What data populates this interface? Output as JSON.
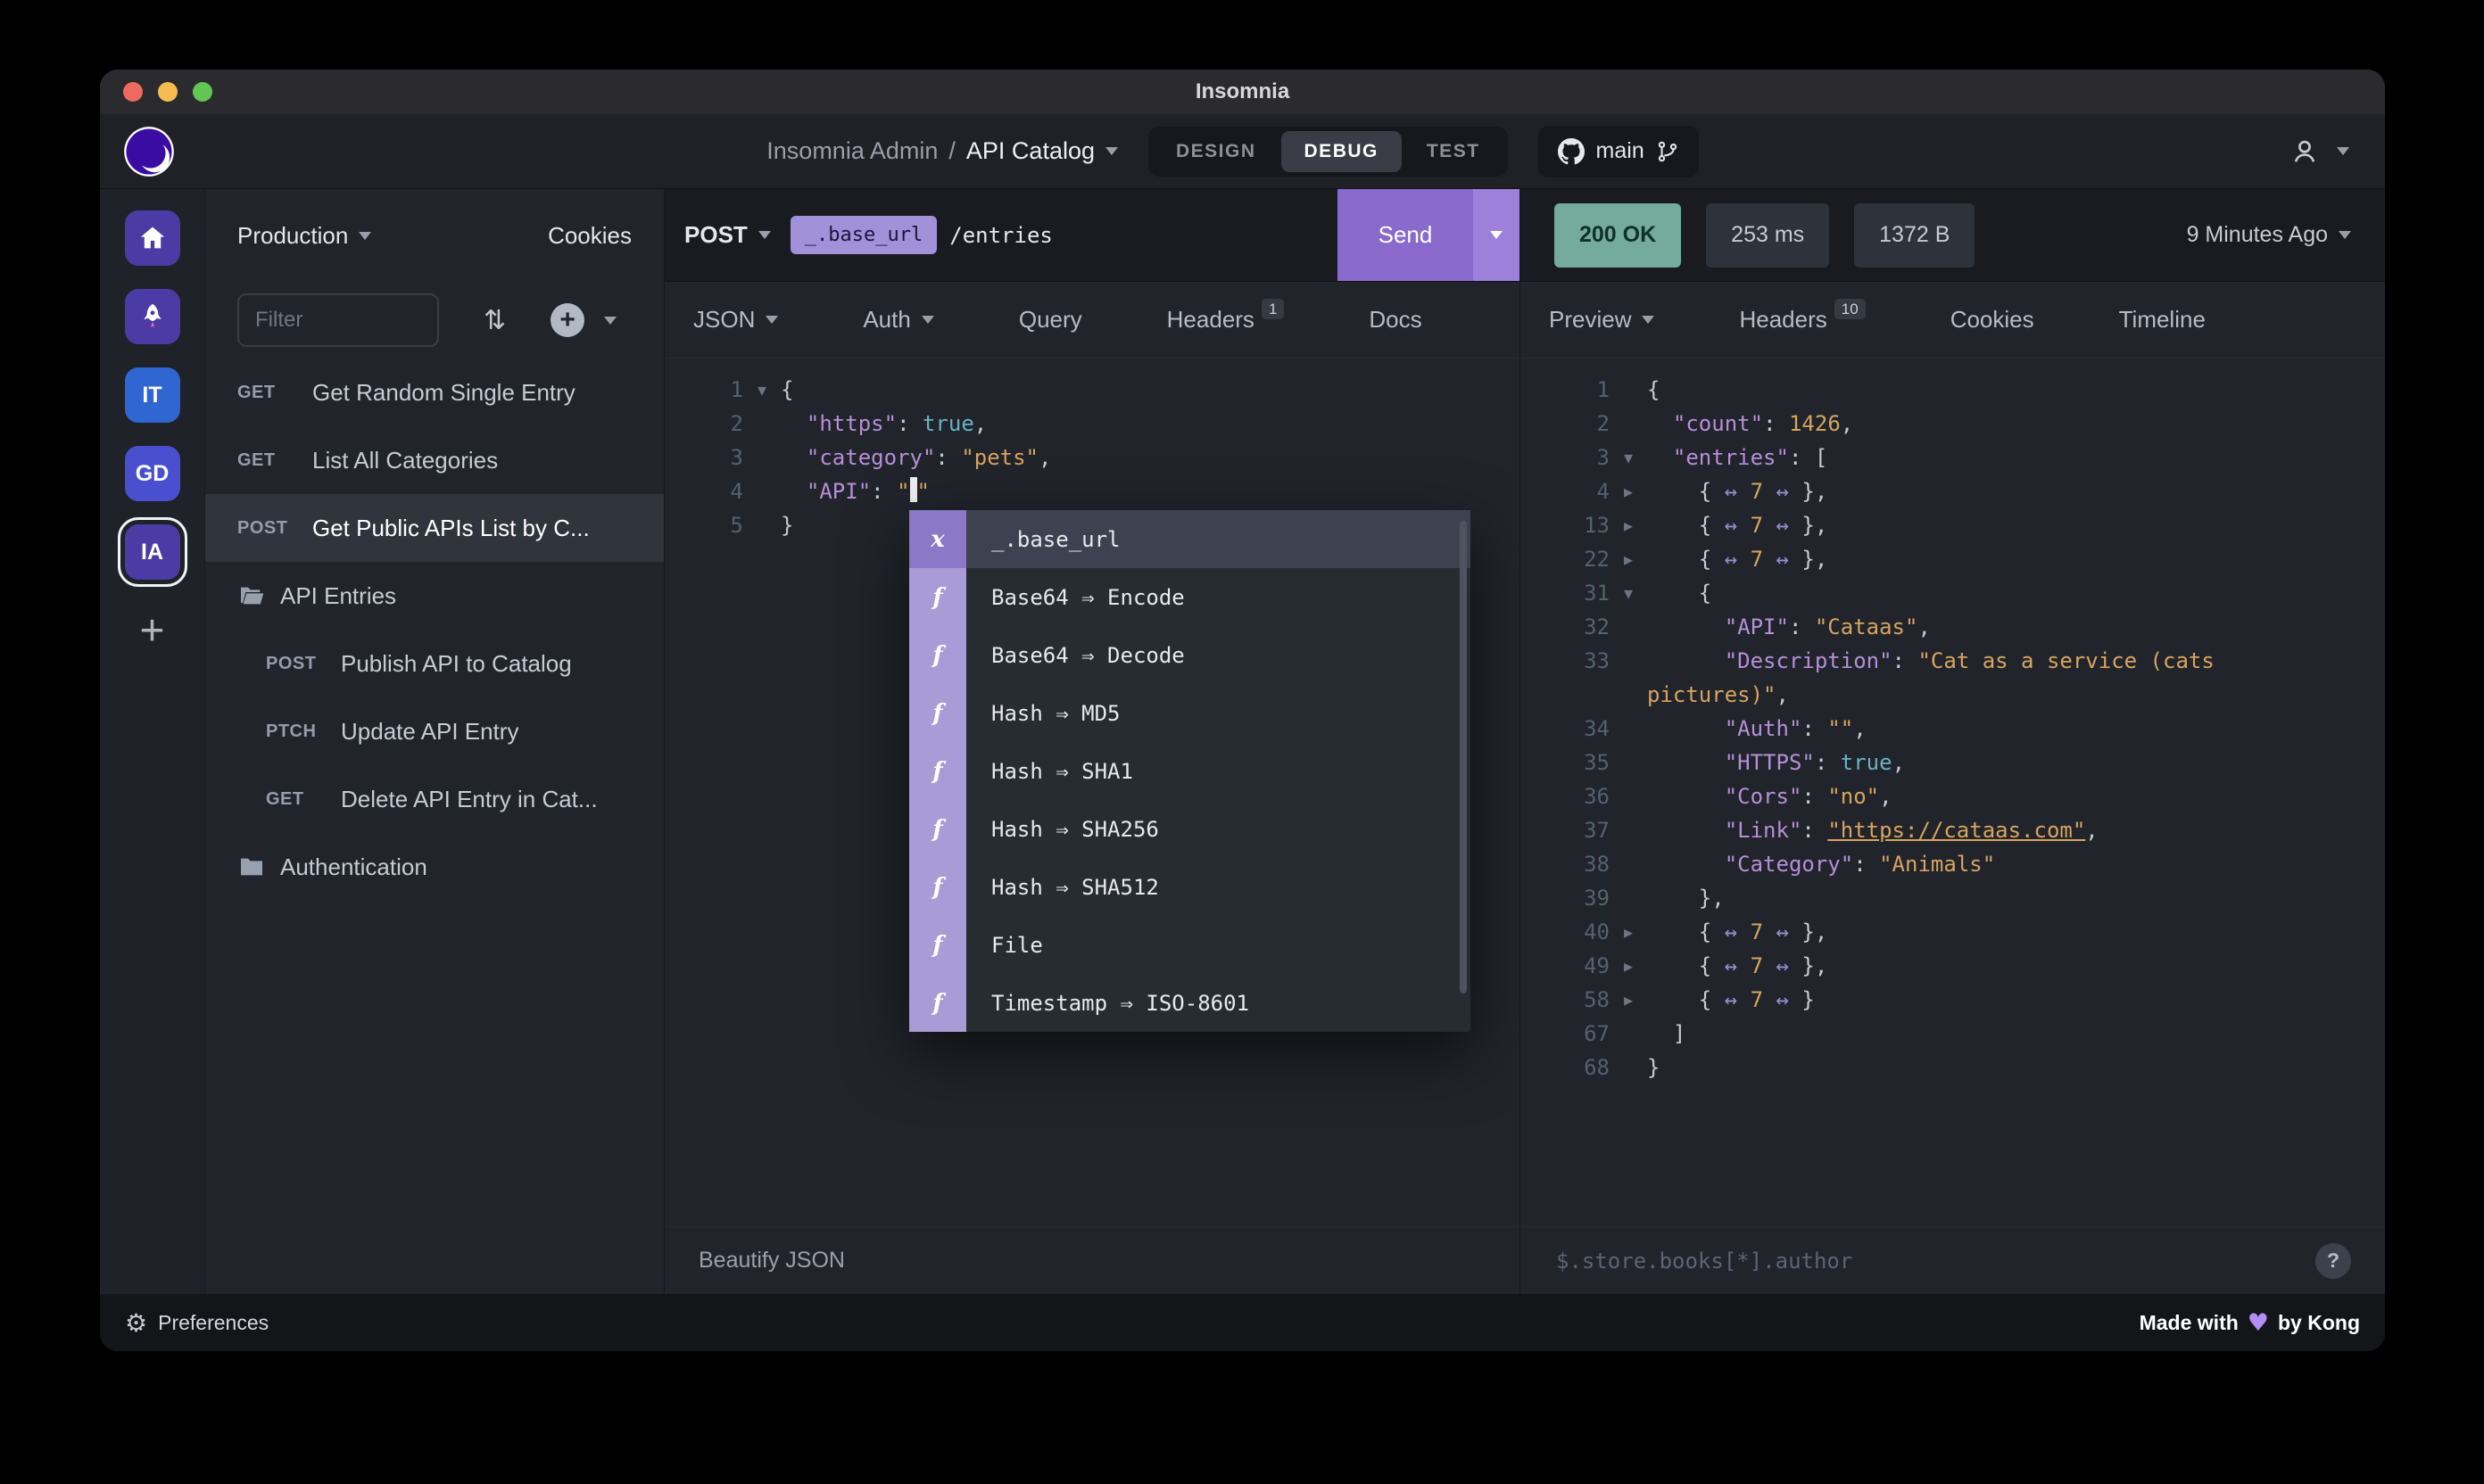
{
  "titlebar": {
    "title": "Insomnia"
  },
  "header": {
    "workspace": "Insomnia Admin",
    "separator": "/",
    "project": "API Catalog",
    "modes": [
      {
        "label": "DESIGN",
        "active": false
      },
      {
        "label": "DEBUG",
        "active": true
      },
      {
        "label": "TEST",
        "active": false
      }
    ],
    "branch": "main"
  },
  "colors": {
    "accent_purple": "#8a69cc",
    "tag_purple": "#a091d9",
    "status_ok_teal": "#74ab9d",
    "syntax_key": "#b58fd8",
    "syntax_string": "#d6a45f",
    "syntax_bool": "#69b2c2"
  },
  "icons": {
    "gear": "⚙",
    "sort": "⇅",
    "plus": "+",
    "help": "?",
    "heart": "♥"
  },
  "rail": [
    {
      "name": "home",
      "icon": "home",
      "color": "#4d3ba5",
      "label": ""
    },
    {
      "name": "rocket",
      "icon": "rocket",
      "color": "#4d3ba5",
      "label": ""
    },
    {
      "name": "workspace-it",
      "color": "#2f66d2",
      "label": "IT"
    },
    {
      "name": "workspace-gd",
      "color": "#4a4fd0",
      "label": "GD"
    },
    {
      "name": "workspace-ia",
      "color": "#4d3ba5",
      "label": "IA",
      "selected": true
    },
    {
      "name": "add-workspace",
      "kind": "add",
      "label": "+"
    }
  ],
  "sidebar": {
    "environment": "Production",
    "cookies": "Cookies",
    "filter_placeholder": "Filter",
    "items": [
      {
        "kind": "request",
        "method": "GET",
        "name": "Get Random Single Entry"
      },
      {
        "kind": "request",
        "method": "GET",
        "name": "List All Categories"
      },
      {
        "kind": "request",
        "method": "POST",
        "name": "Get Public APIs List by C...",
        "selected": true
      },
      {
        "kind": "folder",
        "name": "API Entries",
        "open": true
      },
      {
        "kind": "request",
        "method": "POST",
        "name": "Publish API to Catalog",
        "indent": true
      },
      {
        "kind": "request",
        "method": "PTCH",
        "name": "Update API Entry",
        "indent": true
      },
      {
        "kind": "request",
        "method": "GET",
        "name": "Delete API Entry in Cat...",
        "indent": true
      },
      {
        "kind": "folder",
        "name": "Authentication",
        "open": false
      }
    ]
  },
  "request": {
    "method": "POST",
    "url_tag": "_.base_url",
    "url_path": "/entries",
    "send": "Send",
    "tabs": [
      {
        "label": "JSON",
        "caret": true
      },
      {
        "label": "Auth",
        "caret": true
      },
      {
        "label": "Query"
      },
      {
        "label": "Headers",
        "badge": "1"
      },
      {
        "label": "Docs"
      }
    ],
    "editor_lines": [
      {
        "num": "1",
        "fold": "open",
        "tokens": [
          {
            "t": "{"
          }
        ]
      },
      {
        "num": "2",
        "tokens": [
          {
            "t": "  "
          },
          {
            "t": "\"https\"",
            "c": "key"
          },
          {
            "t": ": "
          },
          {
            "t": "true",
            "c": "bool"
          },
          {
            "t": ","
          }
        ]
      },
      {
        "num": "3",
        "tokens": [
          {
            "t": "  "
          },
          {
            "t": "\"category\"",
            "c": "key"
          },
          {
            "t": ": "
          },
          {
            "t": "\"pets\"",
            "c": "str"
          },
          {
            "t": ","
          }
        ]
      },
      {
        "num": "4",
        "tokens": [
          {
            "t": "  "
          },
          {
            "t": "\"API\"",
            "c": "key"
          },
          {
            "t": ": "
          },
          {
            "t": "\"",
            "c": "str"
          },
          {
            "t": "",
            "c": "cursor"
          },
          {
            "t": "\"",
            "c": "str"
          }
        ]
      },
      {
        "num": "5",
        "tokens": [
          {
            "t": "}"
          }
        ]
      }
    ],
    "autocomplete": [
      {
        "kind": "x",
        "label": "_.base_url",
        "selected": true
      },
      {
        "kind": "f",
        "label": "Base64 ⇒ Encode"
      },
      {
        "kind": "f",
        "label": "Base64 ⇒ Decode"
      },
      {
        "kind": "f",
        "label": "Hash ⇒ MD5"
      },
      {
        "kind": "f",
        "label": "Hash ⇒ SHA1"
      },
      {
        "kind": "f",
        "label": "Hash ⇒ SHA256"
      },
      {
        "kind": "f",
        "label": "Hash ⇒ SHA512"
      },
      {
        "kind": "f",
        "label": "File"
      },
      {
        "kind": "f",
        "label": "Timestamp ⇒ ISO-8601"
      }
    ],
    "beautify": "Beautify JSON"
  },
  "response": {
    "status": "200 OK",
    "time": "253 ms",
    "size": "1372 B",
    "age": "9 Minutes Ago",
    "tabs": [
      {
        "label": "Preview",
        "caret": true
      },
      {
        "label": "Headers",
        "badge": "10"
      },
      {
        "label": "Cookies"
      },
      {
        "label": "Timeline"
      }
    ],
    "editor_lines": [
      {
        "num": "1",
        "tokens": [
          {
            "t": "{"
          }
        ]
      },
      {
        "num": "2",
        "tokens": [
          {
            "t": "  "
          },
          {
            "t": "\"count\"",
            "c": "key"
          },
          {
            "t": ": "
          },
          {
            "t": "1426",
            "c": "num"
          },
          {
            "t": ","
          }
        ]
      },
      {
        "num": "3",
        "fold": "open",
        "tokens": [
          {
            "t": "  "
          },
          {
            "t": "\"entries\"",
            "c": "key"
          },
          {
            "t": ": ["
          }
        ]
      },
      {
        "num": "4",
        "fold": "closed",
        "tokens": [
          {
            "t": "    { "
          },
          {
            "t": "↔",
            "c": "arrow"
          },
          {
            "t": " "
          },
          {
            "t": "7",
            "c": "num"
          },
          {
            "t": " "
          },
          {
            "t": "↔",
            "c": "arrow"
          },
          {
            "t": " },"
          }
        ]
      },
      {
        "num": "13",
        "fold": "closed",
        "tokens": [
          {
            "t": "    { "
          },
          {
            "t": "↔",
            "c": "arrow"
          },
          {
            "t": " "
          },
          {
            "t": "7",
            "c": "num"
          },
          {
            "t": " "
          },
          {
            "t": "↔",
            "c": "arrow"
          },
          {
            "t": " },"
          }
        ]
      },
      {
        "num": "22",
        "fold": "closed",
        "tokens": [
          {
            "t": "    { "
          },
          {
            "t": "↔",
            "c": "arrow"
          },
          {
            "t": " "
          },
          {
            "t": "7",
            "c": "num"
          },
          {
            "t": " "
          },
          {
            "t": "↔",
            "c": "arrow"
          },
          {
            "t": " },"
          }
        ]
      },
      {
        "num": "31",
        "fold": "open",
        "tokens": [
          {
            "t": "    {"
          }
        ]
      },
      {
        "num": "32",
        "tokens": [
          {
            "t": "      "
          },
          {
            "t": "\"API\"",
            "c": "key"
          },
          {
            "t": ": "
          },
          {
            "t": "\"Cataas\"",
            "c": "str"
          },
          {
            "t": ","
          }
        ]
      },
      {
        "num": "33",
        "tokens": [
          {
            "t": "      "
          },
          {
            "t": "\"Description\"",
            "c": "key"
          },
          {
            "t": ": "
          },
          {
            "t": "\"Cat as a service (cats",
            "c": "str"
          }
        ]
      },
      {
        "num": "",
        "tokens": [
          {
            "t": "pictures)\"",
            "c": "str"
          },
          {
            "t": ","
          }
        ]
      },
      {
        "num": "34",
        "tokens": [
          {
            "t": "      "
          },
          {
            "t": "\"Auth\"",
            "c": "key"
          },
          {
            "t": ": "
          },
          {
            "t": "\"\"",
            "c": "str"
          },
          {
            "t": ","
          }
        ]
      },
      {
        "num": "35",
        "tokens": [
          {
            "t": "      "
          },
          {
            "t": "\"HTTPS\"",
            "c": "key"
          },
          {
            "t": ": "
          },
          {
            "t": "true",
            "c": "bool"
          },
          {
            "t": ","
          }
        ]
      },
      {
        "num": "36",
        "tokens": [
          {
            "t": "      "
          },
          {
            "t": "\"Cors\"",
            "c": "key"
          },
          {
            "t": ": "
          },
          {
            "t": "\"no\"",
            "c": "str"
          },
          {
            "t": ","
          }
        ]
      },
      {
        "num": "37",
        "tokens": [
          {
            "t": "      "
          },
          {
            "t": "\"Link\"",
            "c": "key"
          },
          {
            "t": ": "
          },
          {
            "t": "\"https://cataas.com\"",
            "c": "link"
          },
          {
            "t": ","
          }
        ]
      },
      {
        "num": "38",
        "tokens": [
          {
            "t": "      "
          },
          {
            "t": "\"Category\"",
            "c": "key"
          },
          {
            "t": ": "
          },
          {
            "t": "\"Animals\"",
            "c": "str"
          }
        ]
      },
      {
        "num": "39",
        "tokens": [
          {
            "t": "    },"
          }
        ]
      },
      {
        "num": "40",
        "fold": "closed",
        "tokens": [
          {
            "t": "    { "
          },
          {
            "t": "↔",
            "c": "arrow"
          },
          {
            "t": " "
          },
          {
            "t": "7",
            "c": "num"
          },
          {
            "t": " "
          },
          {
            "t": "↔",
            "c": "arrow"
          },
          {
            "t": " },"
          }
        ]
      },
      {
        "num": "49",
        "fold": "closed",
        "tokens": [
          {
            "t": "    { "
          },
          {
            "t": "↔",
            "c": "arrow"
          },
          {
            "t": " "
          },
          {
            "t": "7",
            "c": "num"
          },
          {
            "t": " "
          },
          {
            "t": "↔",
            "c": "arrow"
          },
          {
            "t": " },"
          }
        ]
      },
      {
        "num": "58",
        "fold": "closed",
        "tokens": [
          {
            "t": "    { "
          },
          {
            "t": "↔",
            "c": "arrow"
          },
          {
            "t": " "
          },
          {
            "t": "7",
            "c": "num"
          },
          {
            "t": " "
          },
          {
            "t": "↔",
            "c": "arrow"
          },
          {
            "t": " }"
          }
        ]
      },
      {
        "num": "67",
        "tokens": [
          {
            "t": "  ]"
          }
        ]
      },
      {
        "num": "68",
        "tokens": [
          {
            "t": "}"
          }
        ]
      }
    ],
    "filter_placeholder": "$.store.books[*].author"
  },
  "footer": {
    "preferences": "Preferences",
    "made_prefix": "Made with",
    "by": "by Kong"
  }
}
